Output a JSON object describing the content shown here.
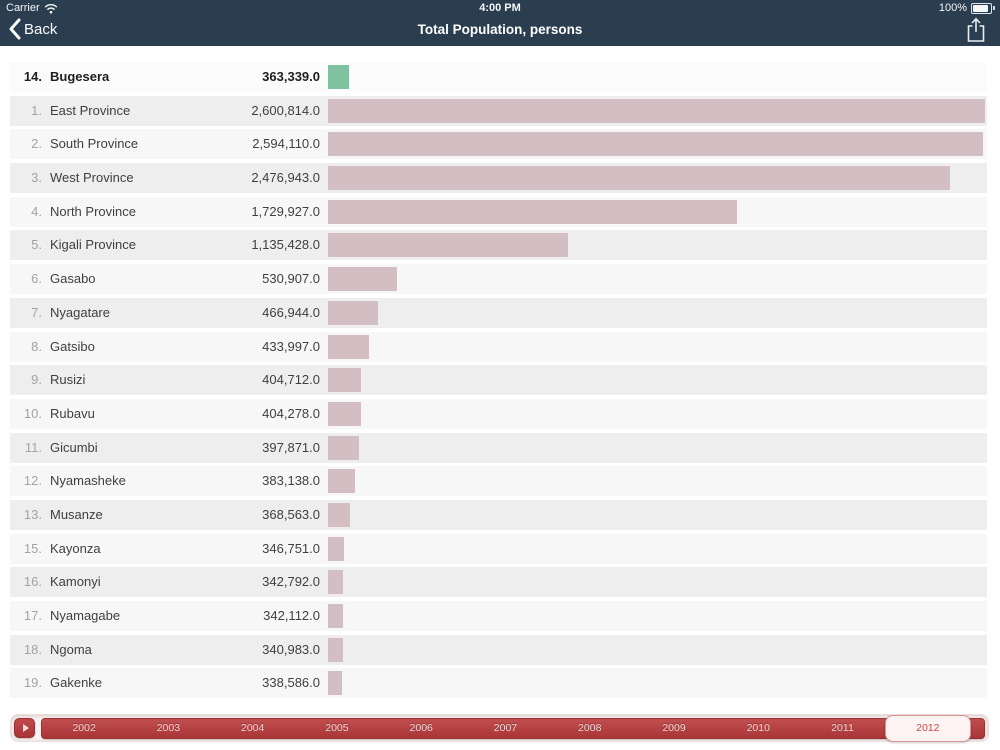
{
  "status_bar": {
    "carrier": "Carrier",
    "time": "4:00 PM",
    "battery": "100%"
  },
  "nav": {
    "back_label": "Back",
    "title": "Total Population, persons"
  },
  "chart_data": {
    "type": "bar",
    "orientation": "horizontal",
    "title": "Total Population, persons",
    "unit": "persons",
    "bar_color": "#d2bec3",
    "highlight_bar_color": "#80c29f",
    "value_axis_range": [
      290000,
      2600814
    ],
    "rows": [
      {
        "rank_label": "14.",
        "name": "Bugesera",
        "value": 363339,
        "value_label": "363,339.0",
        "highlighted": true
      },
      {
        "rank_label": "1.",
        "name": "East Province",
        "value": 2600814,
        "value_label": "2,600,814.0",
        "highlighted": false
      },
      {
        "rank_label": "2.",
        "name": "South Province",
        "value": 2594110,
        "value_label": "2,594,110.0",
        "highlighted": false
      },
      {
        "rank_label": "3.",
        "name": "West Province",
        "value": 2476943,
        "value_label": "2,476,943.0",
        "highlighted": false
      },
      {
        "rank_label": "4.",
        "name": "North Province",
        "value": 1729927,
        "value_label": "1,729,927.0",
        "highlighted": false
      },
      {
        "rank_label": "5.",
        "name": "Kigali Province",
        "value": 1135428,
        "value_label": "1,135,428.0",
        "highlighted": false
      },
      {
        "rank_label": "6.",
        "name": "Gasabo",
        "value": 530907,
        "value_label": "530,907.0",
        "highlighted": false
      },
      {
        "rank_label": "7.",
        "name": "Nyagatare",
        "value": 466944,
        "value_label": "466,944.0",
        "highlighted": false
      },
      {
        "rank_label": "8.",
        "name": "Gatsibo",
        "value": 433997,
        "value_label": "433,997.0",
        "highlighted": false
      },
      {
        "rank_label": "9.",
        "name": "Rusizi",
        "value": 404712,
        "value_label": "404,712.0",
        "highlighted": false
      },
      {
        "rank_label": "10.",
        "name": "Rubavu",
        "value": 404278,
        "value_label": "404,278.0",
        "highlighted": false
      },
      {
        "rank_label": "11.",
        "name": "Gicumbi",
        "value": 397871,
        "value_label": "397,871.0",
        "highlighted": false
      },
      {
        "rank_label": "12.",
        "name": "Nyamasheke",
        "value": 383138,
        "value_label": "383,138.0",
        "highlighted": false
      },
      {
        "rank_label": "13.",
        "name": "Musanze",
        "value": 368563,
        "value_label": "368,563.0",
        "highlighted": false
      },
      {
        "rank_label": "15.",
        "name": "Kayonza",
        "value": 346751,
        "value_label": "346,751.0",
        "highlighted": false
      },
      {
        "rank_label": "16.",
        "name": "Kamonyi",
        "value": 342792,
        "value_label": "342,792.0",
        "highlighted": false
      },
      {
        "rank_label": "17.",
        "name": "Nyamagabe",
        "value": 342112,
        "value_label": "342,112.0",
        "highlighted": false
      },
      {
        "rank_label": "18.",
        "name": "Ngoma",
        "value": 340983,
        "value_label": "340,983.0",
        "highlighted": false
      },
      {
        "rank_label": "19.",
        "name": "Gakenke",
        "value": 338586,
        "value_label": "338,586.0",
        "highlighted": false
      }
    ]
  },
  "timeline": {
    "years": [
      "2002",
      "2003",
      "2004",
      "2005",
      "2006",
      "2007",
      "2008",
      "2009",
      "2010",
      "2011",
      "2012"
    ],
    "selected_year": "2012"
  }
}
